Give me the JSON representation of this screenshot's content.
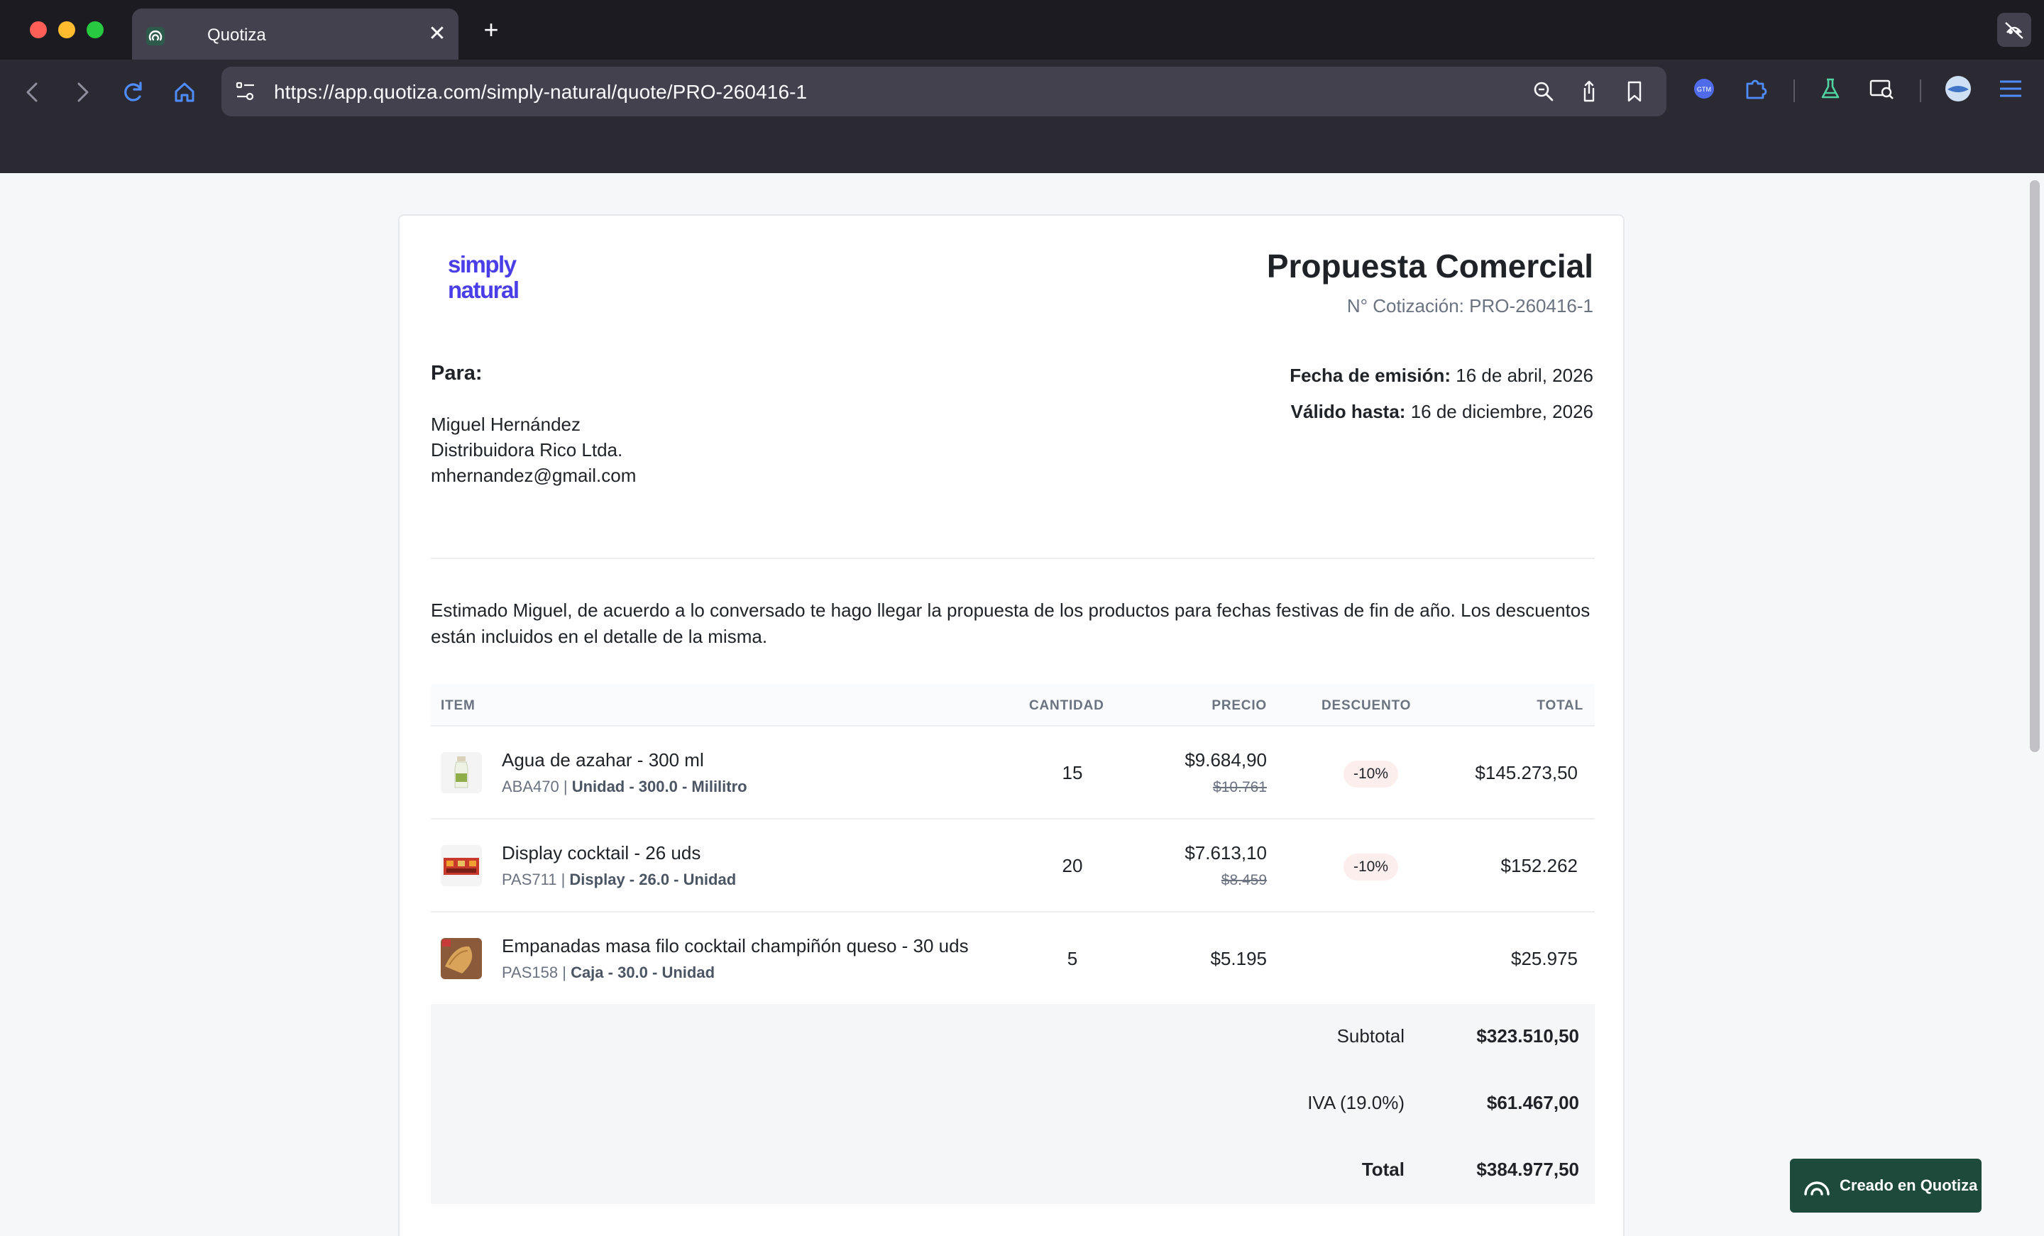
{
  "browser": {
    "tab_title": "Quotiza",
    "tab_close": "✕",
    "new_tab": "+",
    "url": "https://app.quotiza.com/simply-natural/quote/PRO-260416-1"
  },
  "brand": {
    "logo_line1": "simply",
    "logo_line2": "natural",
    "accent": "#4a3ee8"
  },
  "quote": {
    "title": "Propuesta Comercial",
    "number": "N° Cotización: PRO-260416-1",
    "to_label": "Para:",
    "client": {
      "name": "Miguel Hernández",
      "company": "Distribuidora Rico Ltda.",
      "email": "mhernandez@gmail.com"
    },
    "issue_label": "Fecha de emisión:",
    "issue_date": "16 de abril, 2026",
    "valid_label": "Válido hasta:",
    "valid_date": "16 de diciembre, 2026",
    "intro": "Estimado Miguel, de acuerdo a lo conversado te hago llegar la propuesta de los productos para fechas festivas de fin de año. Los descuentos están incluidos en el detalle de la misma."
  },
  "table": {
    "headers": {
      "item": "ITEM",
      "qty": "CANTIDAD",
      "price": "PRECIO",
      "discount": "DESCUENTO",
      "total": "TOTAL"
    },
    "rows": [
      {
        "name": "Agua de azahar - 300 ml",
        "sku": "ABA470",
        "unit": "Unidad - 300.0 - Mililitro",
        "qty": "15",
        "price": "$9.684,90",
        "old_price": "$10.761",
        "discount": "-10%",
        "total": "$145.273,50"
      },
      {
        "name": "Display cocktail - 26 uds",
        "sku": "PAS711",
        "unit": "Display - 26.0 - Unidad",
        "qty": "20",
        "price": "$7.613,10",
        "old_price": "$8.459",
        "discount": "-10%",
        "total": "$152.262"
      },
      {
        "name": "Empanadas masa filo cocktail champiñón queso - 30 uds",
        "sku": "PAS158",
        "unit": "Caja - 30.0 - Unidad",
        "qty": "5",
        "price": "$5.195",
        "total": "$25.975"
      }
    ],
    "separator": " | "
  },
  "totals": {
    "subtotal_label": "Subtotal",
    "subtotal": "$323.510,50",
    "tax_label": "IVA (19.0%)",
    "tax": "$61.467,00",
    "total_label": "Total",
    "total": "$384.977,50"
  },
  "badge": {
    "label": "Creado en Quotiza"
  }
}
